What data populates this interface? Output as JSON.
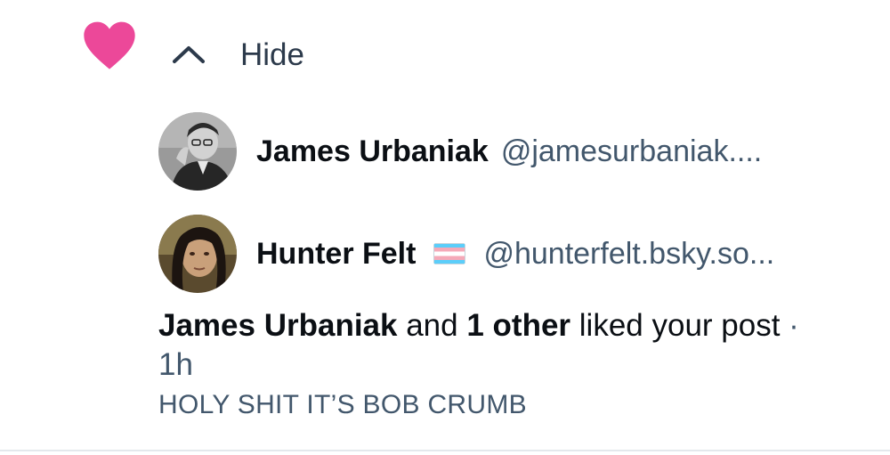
{
  "notification": {
    "hide_label": "Hide",
    "likers": [
      {
        "name": "James Urbaniak",
        "handle": "@jamesurbaniak...."
      },
      {
        "name": "Hunter Felt",
        "handle": "@hunterfelt.bsky.so..."
      }
    ],
    "summary": {
      "actor": "James Urbaniak",
      "connector": " and ",
      "others": "1 other",
      "action": " liked your post",
      "separator": " · ",
      "time": "1h"
    },
    "post_preview": "HOLY SHIT IT’S BOB CRUMB"
  },
  "icons": {
    "like": "heart-icon",
    "toggle": "chevron-up-icon",
    "flag": "transgender-flag-icon"
  },
  "colors": {
    "heart": "#ec4899",
    "primary_text": "#0b0f14",
    "secondary_text": "#42576c",
    "divider": "#e4e8ec"
  }
}
